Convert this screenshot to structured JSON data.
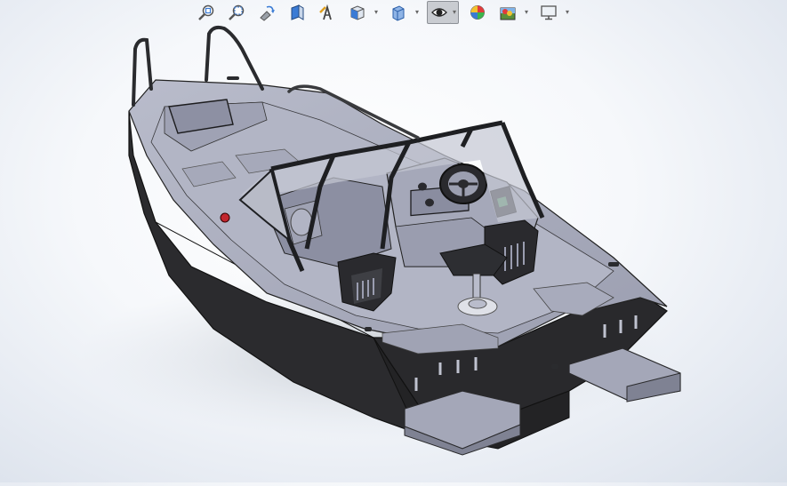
{
  "toolbar": {
    "items": [
      {
        "name": "zoom-to-fit",
        "icon": "zoom-fit-icon"
      },
      {
        "name": "zoom-to-area",
        "icon": "zoom-area-icon"
      },
      {
        "name": "previous-view",
        "icon": "previous-view-icon"
      },
      {
        "name": "section-view",
        "icon": "section-view-icon"
      },
      {
        "name": "dynamic-annotation",
        "icon": "annotation-view-icon"
      },
      {
        "name": "view-orientation",
        "icon": "view-orientation-icon",
        "dropdown": true
      },
      {
        "name": "display-style",
        "icon": "display-style-icon",
        "dropdown": true
      },
      {
        "name": "hide-show-items",
        "icon": "hide-show-icon",
        "dropdown": true,
        "active": true
      },
      {
        "name": "edit-appearance",
        "icon": "edit-appearance-icon"
      },
      {
        "name": "apply-scene",
        "icon": "apply-scene-icon",
        "dropdown": true
      },
      {
        "name": "view-settings",
        "icon": "view-settings-icon",
        "dropdown": true
      }
    ]
  },
  "colors": {
    "hull_dark": "#2a2a2c",
    "deck": "#a9acbd",
    "deck_light": "#c3c6d4",
    "frame": "#1e1f22",
    "glass": "#c9ccd6"
  }
}
